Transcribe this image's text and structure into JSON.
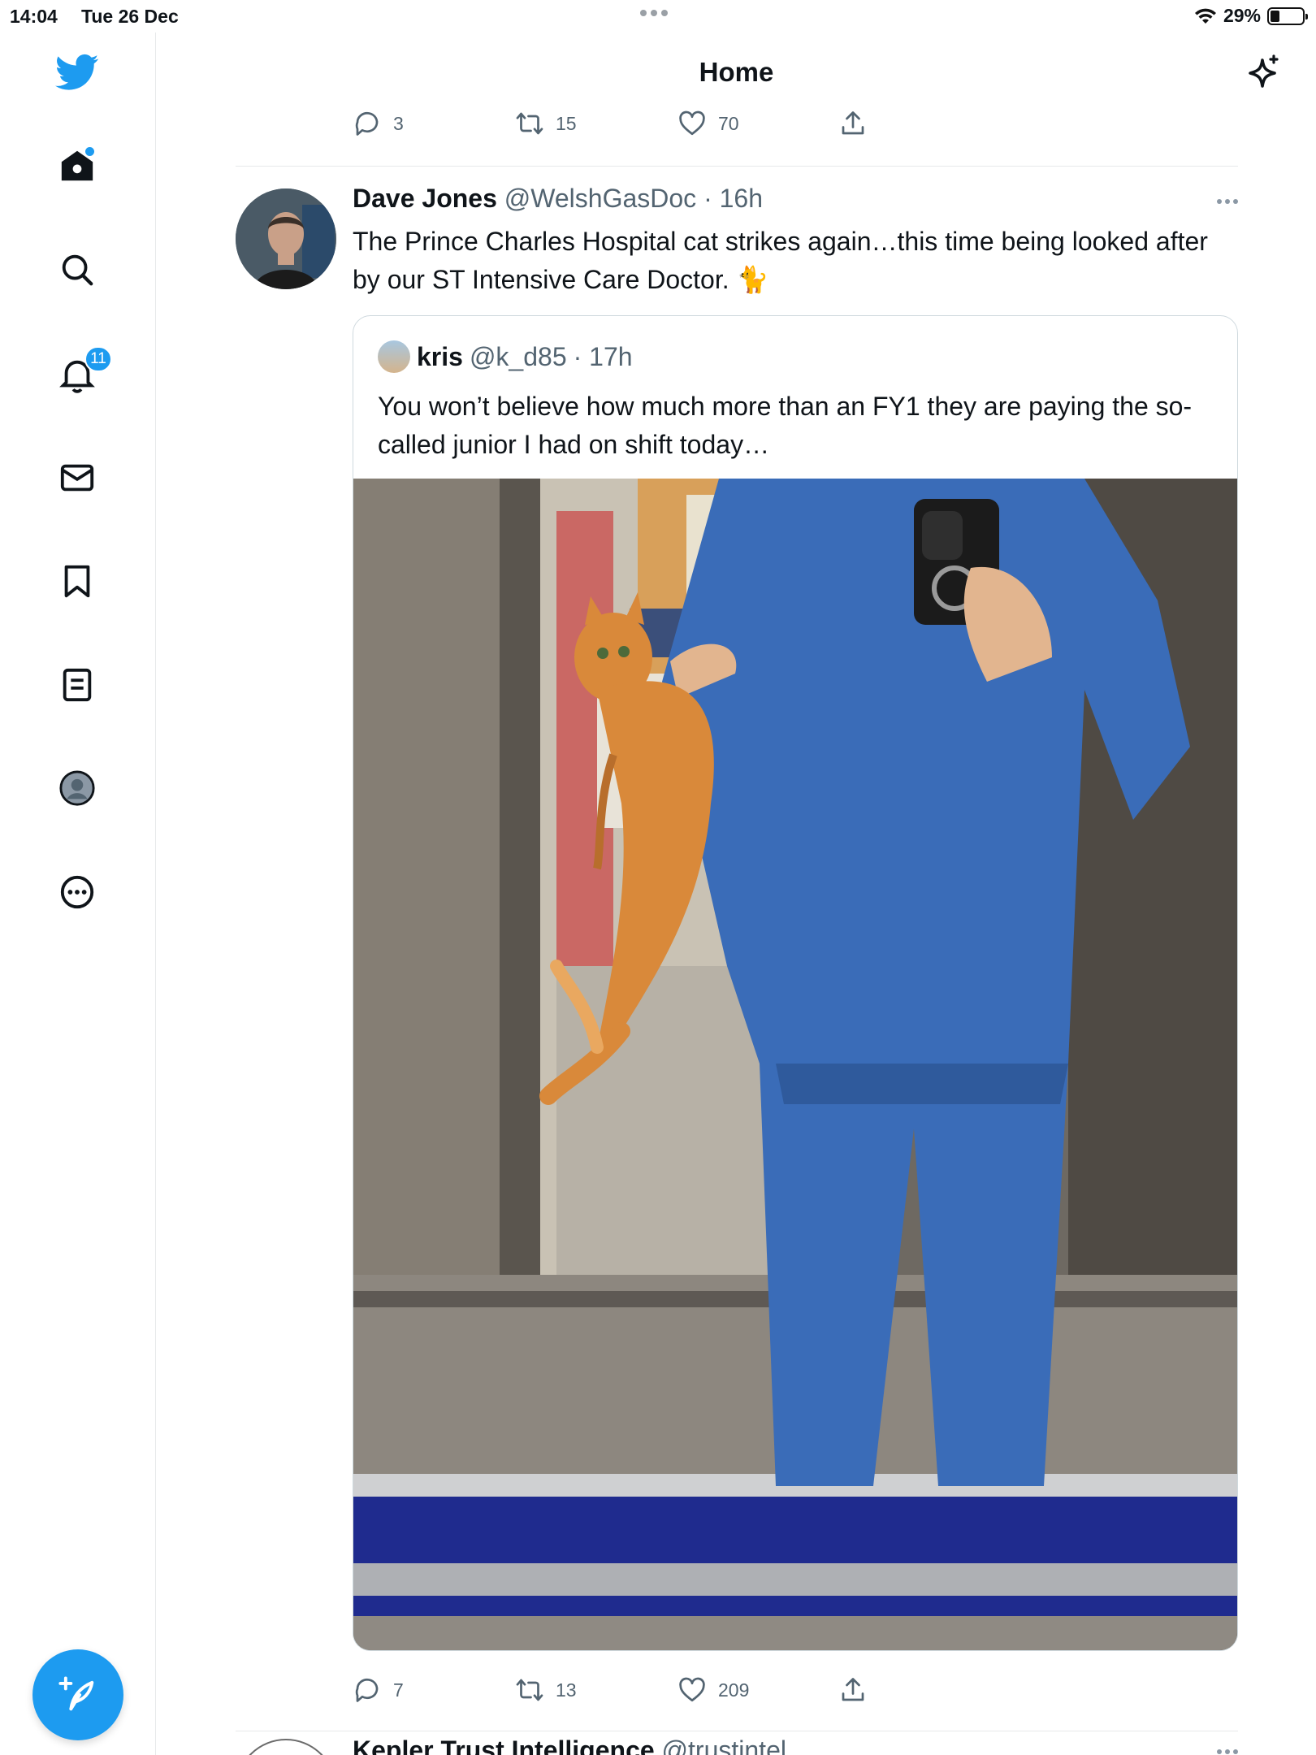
{
  "status_bar": {
    "time": "14:04",
    "date": "Tue 26 Dec",
    "battery": "29%"
  },
  "sidebar": {
    "items": [
      {
        "name": "home",
        "icon": "home-icon"
      },
      {
        "name": "search",
        "icon": "search-icon"
      },
      {
        "name": "notifications",
        "icon": "bell-icon",
        "badge": "11"
      },
      {
        "name": "messages",
        "icon": "mail-icon"
      },
      {
        "name": "bookmarks",
        "icon": "bookmark-icon"
      },
      {
        "name": "lists",
        "icon": "list-icon"
      },
      {
        "name": "profile",
        "icon": "avatar-icon"
      },
      {
        "name": "more",
        "icon": "more-circle-icon"
      }
    ],
    "brand_color": "#1d9bf0"
  },
  "header": {
    "title": "Home"
  },
  "prev_tweet": {
    "replies": "3",
    "retweets": "15",
    "likes": "70"
  },
  "tweet": {
    "name": "Dave Jones",
    "handle": "@WelshGasDoc",
    "time": "· 16h",
    "text": "The Prince Charles Hospital cat strikes again…this time being looked after by our ST Intensive Care Doctor. 🐈",
    "quote": {
      "name": "kris",
      "handle": "@k_d85",
      "time": "· 17h",
      "text": "You won’t believe how much more than an FY1 they are paying the so-called junior I had on shift today…"
    },
    "replies": "7",
    "retweets": "13",
    "likes": "209"
  },
  "next_tweet": {
    "name": "Kepler Trust Intelligence",
    "handle": "@trustintel"
  }
}
